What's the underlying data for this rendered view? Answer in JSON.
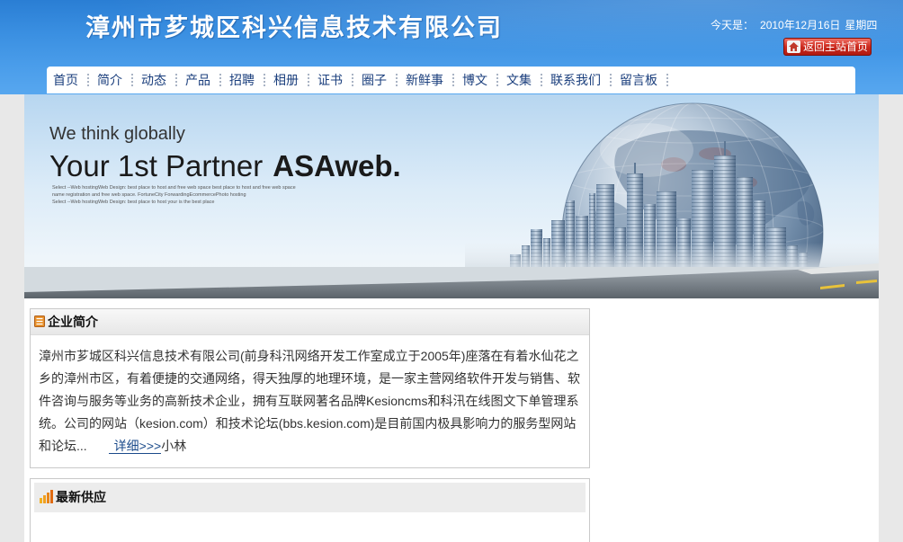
{
  "header": {
    "title": "漳州市芗城区科兴信息技术有限公司",
    "date_label": "今天是：",
    "date": "2010年12月16日",
    "weekday": "星期四",
    "home_button": {
      "label": "返回主站首页",
      "icon": "home-icon"
    }
  },
  "nav": {
    "items": [
      "首页",
      "简介",
      "动态",
      "产品",
      "招聘",
      "相册",
      "证书",
      "圈子",
      "新鲜事",
      "博文",
      "文集",
      "联系我们",
      "留言板"
    ]
  },
  "banner": {
    "tagline": "We think globally",
    "headline": "Your 1st Partner",
    "brand": "ASAweb.",
    "small_text": [
      "Select --Web hostingWeb Design: best place to host and free web space best place to host and free web space",
      "name registration and free web space. FortuneCity ForwardingEcommercePhoto hosting",
      "Select --Web hostingWeb Design: best place to host your is the best place"
    ]
  },
  "intro": {
    "title": "企业简介",
    "icon": "list-icon",
    "lines": [
      "漳州市芗城区科兴信息技术有限公司(前身科汛网络开发工作室成立于2005年)座落在有着水仙花之",
      "乡的漳州市区，有着便捷的交通网络，得天独厚的地理环境，是一家主营网络软件开发与销售、软",
      "件咨询与服务等业务的高新技术企业，拥有互联网著名品牌Kesioncms和科汛在线图文下单管理系",
      "统。公司的网站（kesion.com）和技术论坛(bbs.kesion.com)是目前国内极具影响力的服务型网站"
    ],
    "last_line": "和论坛...",
    "more_link": "详细>>>",
    "author": "小林"
  },
  "supply": {
    "title": "最新供应",
    "icon": "bar-chart-icon"
  },
  "colors": {
    "header_blue": "#2a7ed4",
    "nav_text": "#1b3f7d",
    "button_red": "#cc2a1f",
    "link": "#1a4a8a",
    "page_background": "#e8e8e8",
    "panel_header": "#ececec"
  }
}
